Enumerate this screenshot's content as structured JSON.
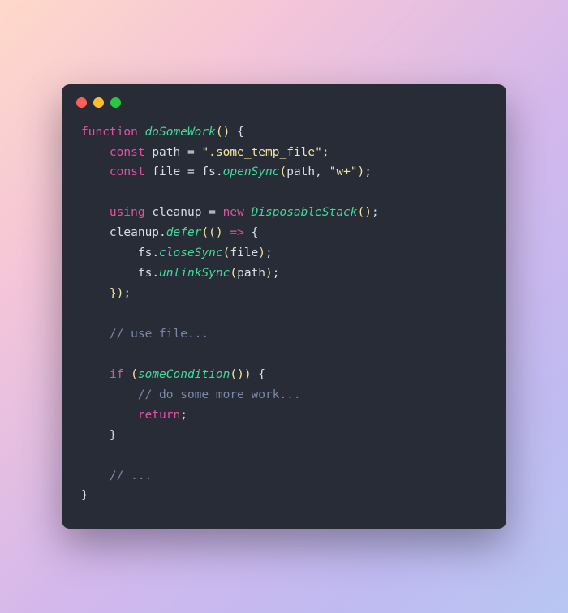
{
  "window": {
    "dot_red": "red",
    "dot_yellow": "yellow",
    "dot_green": "green"
  },
  "code": {
    "l1": {
      "kw": "function",
      "sp": " ",
      "fn": "doSomeWork",
      "paren": "() ",
      "brace": "{"
    },
    "l2": {
      "indent": "    ",
      "kw": "const",
      "sp": " ",
      "id": "path",
      "eq": " = ",
      "str": "\".some_temp_file\"",
      "end": ";"
    },
    "l3": {
      "indent": "    ",
      "kw": "const",
      "sp": " ",
      "id": "file",
      "eq": " = ",
      "obj": "fs",
      "dot": ".",
      "fn": "openSync",
      "paren_o": "(",
      "arg1": "path",
      "comma": ", ",
      "str": "\"w+\"",
      "paren_c": ")",
      "end": ";"
    },
    "l4": {
      "blank": ""
    },
    "l5": {
      "indent": "    ",
      "kw": "using",
      "sp": " ",
      "id": "cleanup",
      "eq": " = ",
      "new": "new",
      "sp2": " ",
      "type": "DisposableStack",
      "paren": "()",
      "end": ";"
    },
    "l6": {
      "indent": "    ",
      "obj": "cleanup",
      "dot": ".",
      "fn": "defer",
      "paren_o": "(",
      "arrow_o": "() ",
      "arrow": "=>",
      "sp": " ",
      "brace": "{"
    },
    "l7": {
      "indent": "        ",
      "obj": "fs",
      "dot": ".",
      "fn": "closeSync",
      "paren_o": "(",
      "arg": "file",
      "paren_c": ")",
      "end": ";"
    },
    "l8": {
      "indent": "        ",
      "obj": "fs",
      "dot": ".",
      "fn": "unlinkSync",
      "paren_o": "(",
      "arg": "path",
      "paren_c": ")",
      "end": ";"
    },
    "l9": {
      "indent": "    ",
      "brace": "})",
      "end": ";"
    },
    "l10": {
      "blank": ""
    },
    "l11": {
      "indent": "    ",
      "comment": "// use file..."
    },
    "l12": {
      "blank": ""
    },
    "l13": {
      "indent": "    ",
      "kw": "if",
      "sp": " ",
      "paren_o": "(",
      "fn": "someCondition",
      "call": "()",
      "paren_c": ")",
      "sp2": " ",
      "brace": "{"
    },
    "l14": {
      "indent": "        ",
      "comment": "// do some more work..."
    },
    "l15": {
      "indent": "        ",
      "kw": "return",
      "end": ";"
    },
    "l16": {
      "indent": "    ",
      "brace": "}"
    },
    "l17": {
      "blank": ""
    },
    "l18": {
      "indent": "    ",
      "comment": "// ..."
    },
    "l19": {
      "brace": "}"
    }
  }
}
